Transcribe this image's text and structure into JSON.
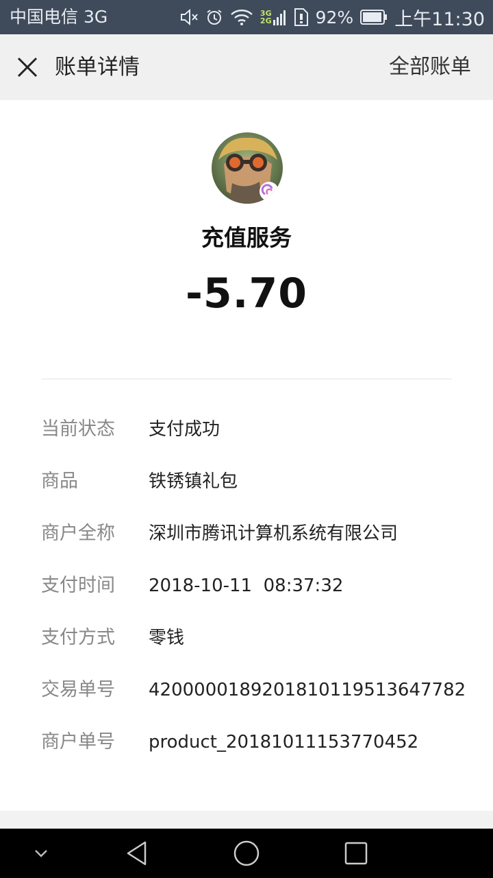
{
  "status_bar": {
    "carrier": "中国电信 3G",
    "network_top": "3G",
    "network_bottom": "2G",
    "battery": "92%",
    "time": "上午11:30"
  },
  "header": {
    "title": "账单详情",
    "right_link": "全部账单",
    "close_icon": "close-icon"
  },
  "summary": {
    "service_name": "充值服务",
    "amount": "-5.70"
  },
  "details": [
    {
      "label": "当前状态",
      "value": "支付成功"
    },
    {
      "label": "商品",
      "value": "铁锈镇礼包"
    },
    {
      "label": "商户全称",
      "value": "深圳市腾讯计算机系统有限公司"
    },
    {
      "label": "支付时间",
      "value": "2018-10-11  08:37:32"
    },
    {
      "label": "支付方式",
      "value": "零钱"
    },
    {
      "label": "交易单号",
      "value": "4200000189201810119513647782"
    },
    {
      "label": "商户单号",
      "value": "product_20181011153770452"
    }
  ],
  "nav": {
    "icons": [
      "chevron-down-icon",
      "back-icon",
      "home-icon",
      "recents-icon"
    ]
  }
}
